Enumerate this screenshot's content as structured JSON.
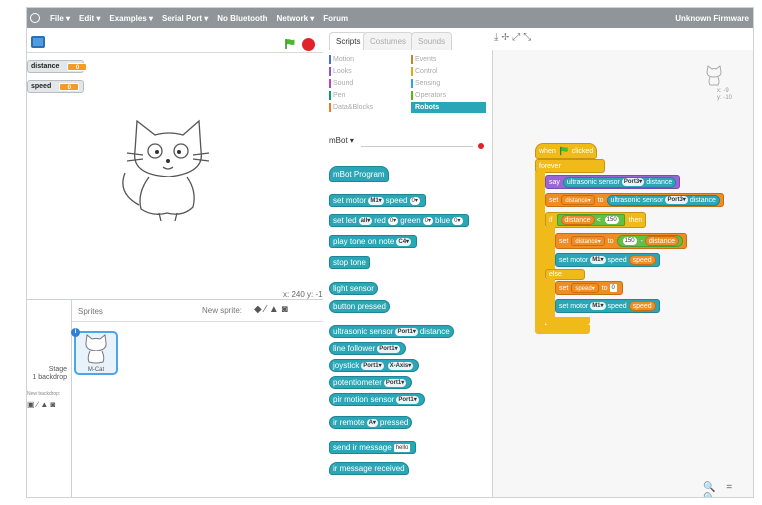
{
  "menu": {
    "items": [
      "File ▾",
      "Edit ▾",
      "Examples ▾",
      "Serial Port ▾",
      "No Bluetooth",
      "Network ▾",
      "Forum"
    ],
    "firmware": "Unknown Firmware"
  },
  "stage": {
    "monitors": [
      {
        "label": "distance",
        "value": "0"
      },
      {
        "label": "speed",
        "value": "0"
      }
    ],
    "coords": "x: 240  y: -109"
  },
  "sprites": {
    "title": "Sprites",
    "new_sprite": "New sprite:",
    "stage_label": "Stage",
    "backdrop_count": "1 backdrop",
    "new_backdrop": "New backdrop:",
    "sprite_name": "M-Cat",
    "info": "i"
  },
  "tabs": [
    "Scripts",
    "Costumes",
    "Sounds"
  ],
  "categories": {
    "left": [
      "Motion",
      "Looks",
      "Sound",
      "Pen",
      "Data&Blocks"
    ],
    "right": [
      "Events",
      "Control",
      "Sensing",
      "Operators",
      "Robots"
    ]
  },
  "palette": {
    "mbot_label": "mBot ▾",
    "mbot_program": "mBot Program",
    "set_motor": "set motor",
    "m1": "M1▾",
    "speed": "speed",
    "zero": "0▾",
    "set_led": "set led",
    "all": "all▾",
    "red": "red",
    "green": "green",
    "blue": "blue",
    "play_tone": "play tone on note",
    "c4": "C4▾",
    "stop_tone": "stop tone",
    "light_sensor": "light sensor",
    "button_pressed": "button pressed",
    "ultrasonic": "ultrasonic sensor",
    "port1": "Port1▾",
    "distance": "distance",
    "line_follower": "line follower",
    "joystick": "joystick",
    "xaxis": "X-Axis▾",
    "potentiometer": "potentiometer",
    "pir": "pir motion sensor",
    "ir_remote": "ir remote",
    "a": "A▾",
    "pressed": "pressed",
    "send_ir": "send ir message",
    "hello": "hello",
    "ir_received": "ir message received"
  },
  "script": {
    "when": "when",
    "clicked": "clicked",
    "forever": "forever",
    "say": "say",
    "ultrasonic": "ultrasonic sensor",
    "port3": "Port3▾",
    "distance": "distance",
    "set": "set",
    "distance_var": "distance▾",
    "to": "to",
    "if": "if",
    "lt": "<",
    "num150": "150",
    "then": "then",
    "minus": "-",
    "set_motor": "set motor",
    "m1": "M1▾",
    "speed": "speed",
    "else": "else",
    "speed_var": "speed▾",
    "zero": "0"
  },
  "sprite_xy": {
    "x": "x: -9",
    "y": "y: -10"
  },
  "zoom": "🔍 = 🔍"
}
